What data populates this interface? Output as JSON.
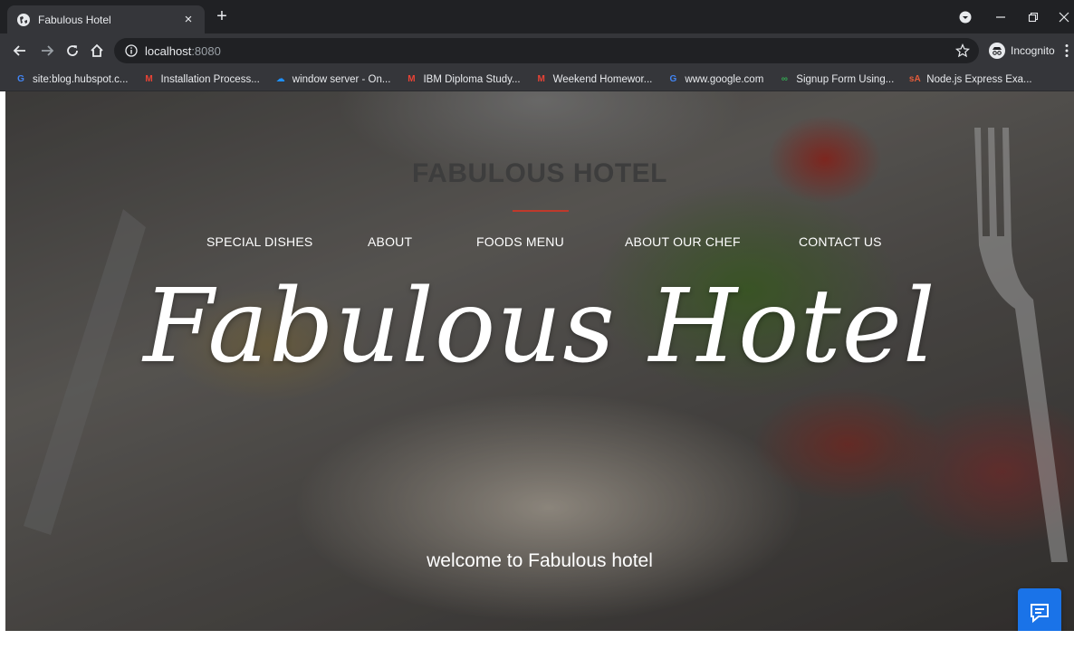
{
  "browser": {
    "tab": {
      "title": "Fabulous Hotel",
      "close": "×"
    },
    "new_tab": "+",
    "address": {
      "host": "localhost",
      "port": ":8080"
    },
    "profile_label": "Incognito",
    "bookmarks": [
      {
        "label": "site:blog.hubspot.c...",
        "icon": "google-icon",
        "icon_color": "#4285f4"
      },
      {
        "label": "Installation Process...",
        "icon": "gmail-icon",
        "icon_color": "#ea4335"
      },
      {
        "label": "window server - On...",
        "icon": "cloud-icon",
        "icon_color": "#1e90ff"
      },
      {
        "label": "IBM Diploma Study...",
        "icon": "gmail-icon",
        "icon_color": "#ea4335"
      },
      {
        "label": "Weekend Homewor...",
        "icon": "gmail-icon",
        "icon_color": "#ea4335"
      },
      {
        "label": "www.google.com",
        "icon": "google-icon",
        "icon_color": "#4285f4"
      },
      {
        "label": "Signup Form Using...",
        "icon": "gg-icon",
        "icon_color": "#34a853"
      },
      {
        "label": "Node.js Express Exa...",
        "icon": "sa-icon",
        "icon_color": "#e25c3b"
      }
    ]
  },
  "page": {
    "brand": "FABULOUS HOTEL",
    "accent_color": "#c0392b",
    "nav": [
      "SPECIAL DISHES",
      "ABOUT",
      "FOODS MENU",
      "ABOUT OUR CHEF",
      "CONTACT US"
    ],
    "hero_title": "Fabulous Hotel",
    "welcome": "welcome to Fabulous hotel",
    "chat_button_color": "#1a73e8"
  }
}
